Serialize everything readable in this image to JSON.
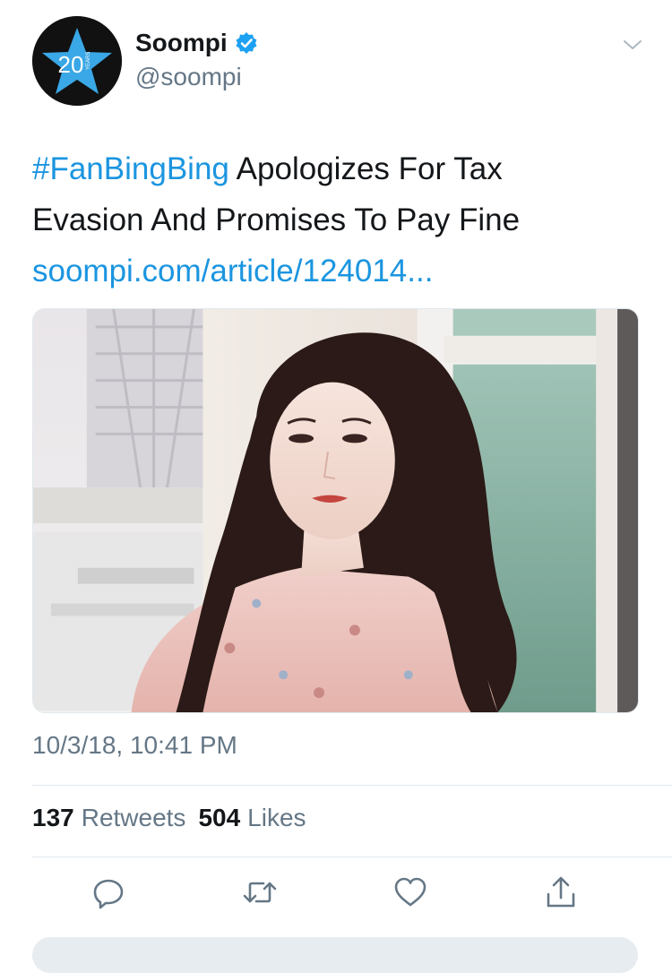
{
  "account": {
    "display_name": "Soompi",
    "handle": "@soompi",
    "avatar_text": "20",
    "avatar_subtext": "YEARS",
    "verified": true
  },
  "tweet": {
    "hashtag": "#FanBingBing",
    "text_line1": " Apologizes For Tax",
    "text_line2": "Evasion And Promises To Pay Fine",
    "link": "soompi.com/article/124014...",
    "timestamp": "10/3/18, 10:41 PM"
  },
  "stats": {
    "retweets_count": "137",
    "retweets_label": "Retweets",
    "likes_count": "504",
    "likes_label": "Likes"
  },
  "icons": {
    "more": "chevron-down-icon",
    "reply": "reply-icon",
    "retweet": "retweet-icon",
    "like": "heart-icon",
    "share": "share-icon"
  },
  "colors": {
    "link": "#1b95e0",
    "text": "#14171a",
    "muted": "#657786",
    "divider": "#e1e8ed",
    "avatar_bg": "#111111",
    "avatar_star": "#3aa7e6"
  }
}
